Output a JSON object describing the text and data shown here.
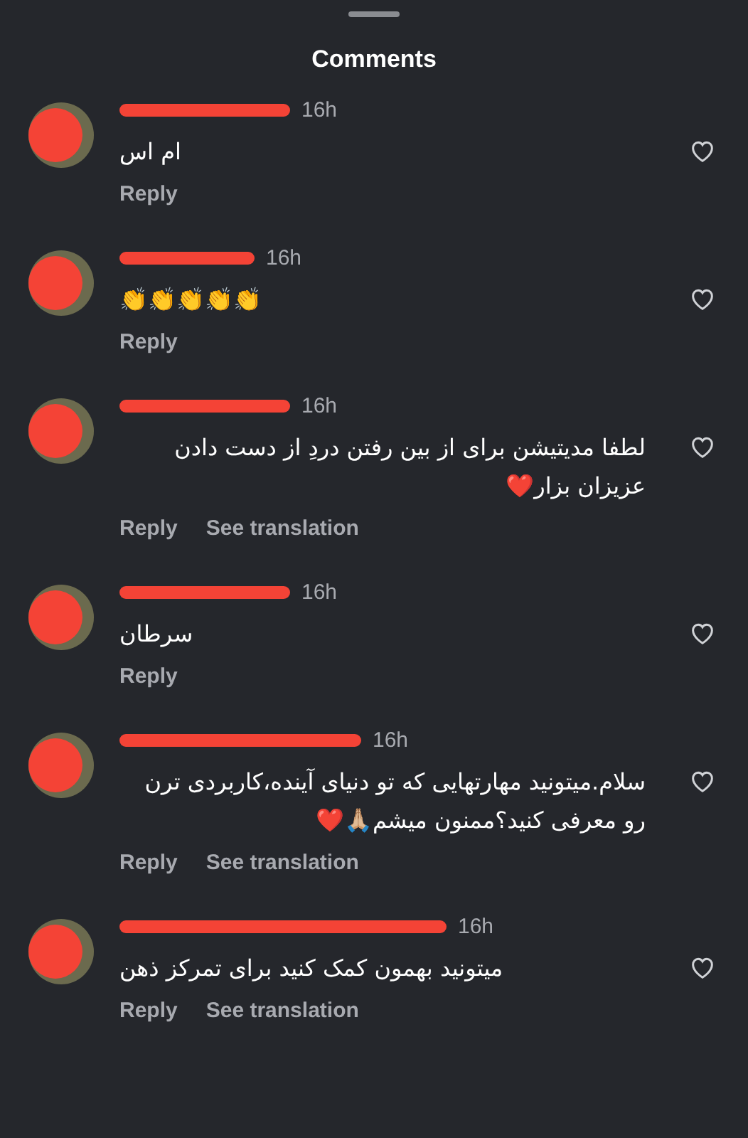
{
  "title": "Comments",
  "comments": [
    {
      "time": "16h",
      "text": "ام اس",
      "actions": [
        "Reply"
      ],
      "liked": false
    },
    {
      "time": "16h",
      "text": "👏👏👏👏👏",
      "actions": [
        "Reply"
      ],
      "liked": false
    },
    {
      "time": "16h",
      "text": "لطفا مدیتیشن برای از بین رفتن دردِ از دست دادن عزیزان بزار❤️",
      "actions": [
        "Reply",
        "See translation"
      ],
      "liked": false
    },
    {
      "time": "16h",
      "text": "سرطان",
      "actions": [
        "Reply"
      ],
      "liked": false
    },
    {
      "time": "16h",
      "text": "سلام.میتونید مهارتهایی که تو دنیای آینده،کاربردی ترن رو معرفی کنید؟ممنون میشم🙏🏼❤️",
      "actions": [
        "Reply",
        "See translation"
      ],
      "liked": false
    },
    {
      "time": "16h",
      "text": "میتونید بهمون کمک کنید برای تمرکز ذهن",
      "actions": [
        "Reply",
        "See translation"
      ],
      "liked": false
    }
  ]
}
